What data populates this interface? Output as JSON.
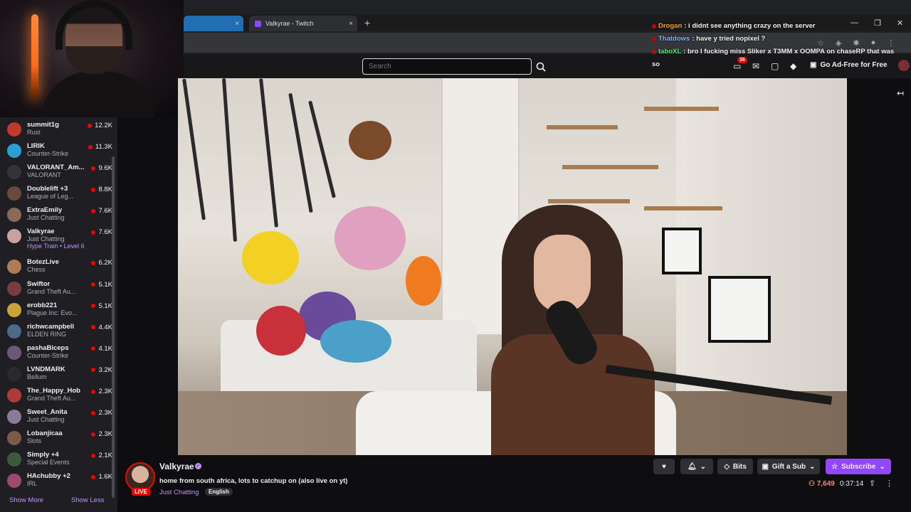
{
  "browser": {
    "tab_active_label": "",
    "tab_label": "Valkyrae - Twitch",
    "tab_close": "×",
    "new_tab": "+",
    "controls": [
      "—",
      "❐",
      "✕"
    ]
  },
  "topnav": {
    "search_placeholder": "Search",
    "notification_count": "36",
    "ad_free_label": "Go Ad-Free for Free"
  },
  "chat": [
    {
      "user": "Drogan",
      "msg": ": i didnt see anything crazy on the server",
      "color": "#ff9e2a"
    },
    {
      "user": "Thatdows",
      "msg": ": have y tried nopixel ?",
      "color": "#7bb6ff"
    },
    {
      "user": "taboXL",
      "msg": ": bro I fucking miss Sliker x T3MM x OOMPA on chaseRP that was",
      "color": "#5ee07a"
    },
    {
      "user": "",
      "msg": "so",
      "color": "#f3f3f3"
    }
  ],
  "sidebar": {
    "channels": [
      {
        "name": "summit1g",
        "game": "Rust",
        "viewers": "12.2K",
        "color": "#c0392b"
      },
      {
        "name": "LIRIK",
        "game": "Counter-Strike",
        "viewers": "11.3K",
        "color": "#2a9fd6"
      },
      {
        "name": "VALORANT_Am...",
        "game": "VALORANT",
        "viewers": "9.6K",
        "color": "#33343a"
      },
      {
        "name": "Doublelift +3",
        "game": "League of Leg...",
        "viewers": "8.8K",
        "color": "#6a4a3c"
      },
      {
        "name": "ExtraEmily",
        "game": "Just Chatting",
        "viewers": "7.6K",
        "color": "#8a6b5a"
      },
      {
        "name": "Valkyrae",
        "game": "Just Chatting",
        "viewers": "7.6K",
        "color": "#c9a2a0",
        "hype": "Hype Train • Level 6"
      },
      {
        "name": "BotezLive",
        "game": "Chess",
        "viewers": "6.2K",
        "color": "#b07a55"
      },
      {
        "name": "Swiftor",
        "game": "Grand Theft Au...",
        "viewers": "5.1K",
        "color": "#7a3d3d"
      },
      {
        "name": "erobb221",
        "game": "Plague Inc: Evo...",
        "viewers": "5.1K",
        "color": "#caa13a"
      },
      {
        "name": "richwcampbell",
        "game": "ELDEN RING",
        "viewers": "4.4K",
        "color": "#4a6a8a"
      },
      {
        "name": "pashaBiceps",
        "game": "Counter-Strike",
        "viewers": "4.1K",
        "color": "#6a5a7a"
      },
      {
        "name": "LVNDMARK",
        "game": "Bellum",
        "viewers": "3.2K",
        "color": "#2a2a2a"
      },
      {
        "name": "The_Happy_Hob",
        "game": "Grand Theft Au...",
        "viewers": "2.3K",
        "color": "#b03a3a"
      },
      {
        "name": "Sweet_Anita",
        "game": "Just Chatting",
        "viewers": "2.3K",
        "color": "#8a7a9a"
      },
      {
        "name": "Lobanjicaa",
        "game": "Slots",
        "viewers": "2.3K",
        "color": "#7a5a4a"
      },
      {
        "name": "Simply +4",
        "game": "Special Events",
        "viewers": "2.1K",
        "color": "#3a5a3a"
      },
      {
        "name": "HAchubby +2",
        "game": "IRL",
        "viewers": "1.6K",
        "color": "#9a4a6a"
      }
    ],
    "show_more": "Show More",
    "show_less": "Show Less"
  },
  "stream": {
    "live_badge": "LIVE",
    "streamer": "Valkyrae",
    "title": "home from south africa, lots to catchup on (also live on yt)",
    "category": "Just Chatting",
    "language": "English",
    "viewers": "7,649",
    "uptime": "0:37:14"
  },
  "actions": {
    "bits": "Bits",
    "gift": "Gift a Sub",
    "subscribe": "Subscribe"
  },
  "colors": {
    "accent": "#9146ff",
    "live": "#eb0400",
    "link": "#bf94ff"
  }
}
